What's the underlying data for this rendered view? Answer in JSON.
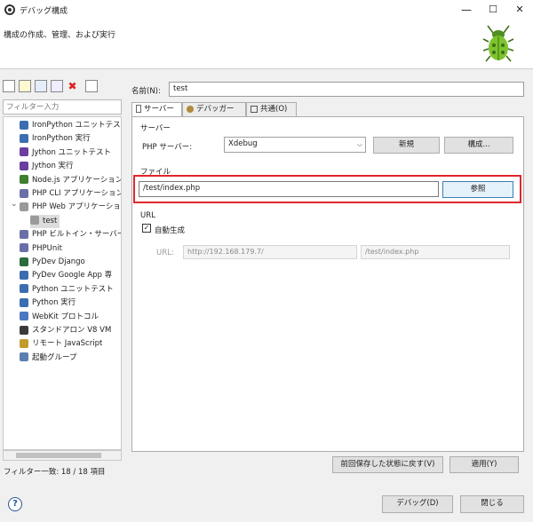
{
  "window": {
    "title": "デバッグ構成",
    "minimize": "—",
    "maximize": "☐",
    "close": "✕"
  },
  "header": {
    "description": "構成の作成、管理、および実行"
  },
  "left": {
    "filter_placeholder": "フィルター入力",
    "tree": [
      {
        "label": "IronPython ユニットテス",
        "color": "#3b6db0"
      },
      {
        "label": "IronPython 実行",
        "color": "#3b6db0"
      },
      {
        "label": "Jython ユニットテスト",
        "color": "#6a3fa0"
      },
      {
        "label": "Jython 実行",
        "color": "#6a3fa0"
      },
      {
        "label": "Node.js アプリケーション",
        "color": "#3f7f2f"
      },
      {
        "label": "PHP CLI アプリケーション",
        "color": "#6b6fa8"
      },
      {
        "label": "PHP Web アプリケーショ",
        "color": "#9a9a9a"
      },
      {
        "label": "test",
        "color": "#9a9a9a"
      },
      {
        "label": "PHP ビルトイン・サーバー",
        "color": "#6b6fa8"
      },
      {
        "label": "PHPUnit",
        "color": "#6b6fa8"
      },
      {
        "label": "PyDev Django",
        "color": "#2d6a3c"
      },
      {
        "label": "PyDev Google App 専",
        "color": "#3b6db0"
      },
      {
        "label": "Python ユニットテスト",
        "color": "#3b6db0"
      },
      {
        "label": "Python 実行",
        "color": "#3b6db0"
      },
      {
        "label": "WebKit プロトコル",
        "color": "#4a78c2"
      },
      {
        "label": "スタンドアロン V8 VM",
        "color": "#3a3a3a"
      },
      {
        "label": "リモート JavaScript",
        "color": "#c29b2d"
      },
      {
        "label": "起動グループ",
        "color": "#5a7fb0"
      }
    ],
    "filter_status": "フィルター一致: 18 / 18 項目"
  },
  "form": {
    "name_label": "名前(N):",
    "name_value": "test",
    "tabs": [
      {
        "label": "サーバー"
      },
      {
        "label": "デバッガー"
      },
      {
        "label": "共通(O)"
      }
    ],
    "server_section": "サーバー",
    "php_server_label": "PHP サーバー:",
    "php_server_value": "Xdebug",
    "new_button": "新規",
    "configure_button": "構成...",
    "file_section": "ファイル",
    "file_value": "/test/index.php",
    "browse_button": "参照",
    "url_section": "URL",
    "auto_generate_label": "自動生成",
    "url_label": "URL:",
    "url_base": "http://192.168.179.7/",
    "url_path": "/test/index.php"
  },
  "footer": {
    "revert_button": "前回保存した状態に戻す(V)",
    "apply_button": "適用(Y)",
    "debug_button": "デバッグ(D)",
    "close_button": "閉じる",
    "help": "?"
  }
}
